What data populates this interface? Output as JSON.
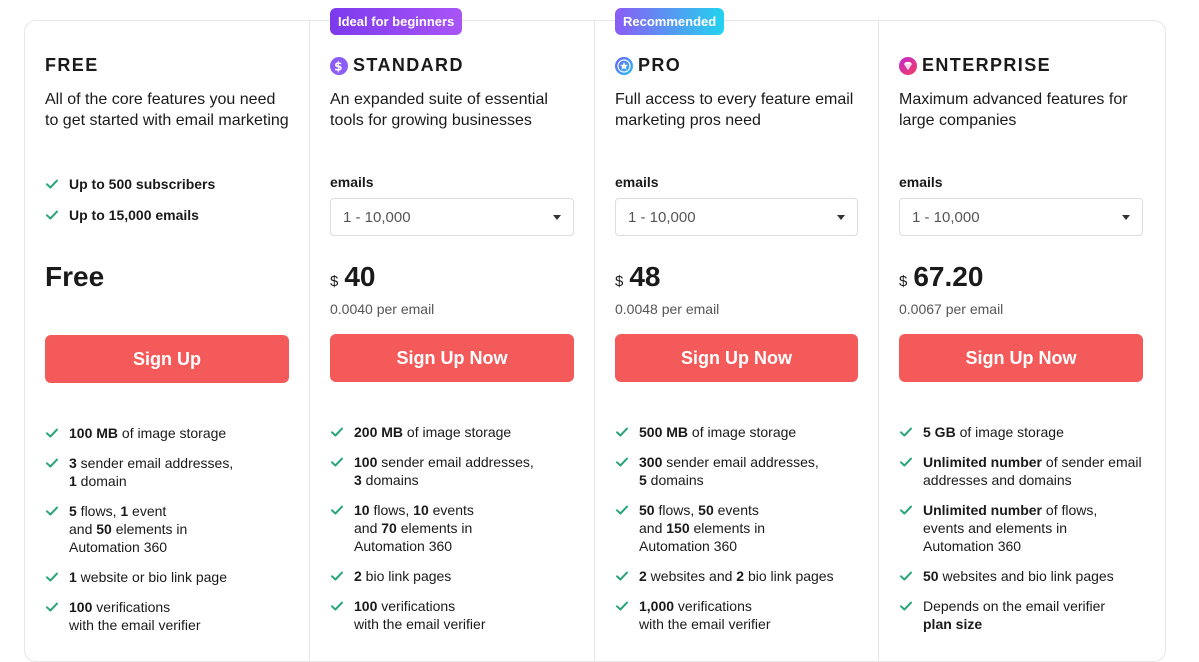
{
  "colors": {
    "accent": "#f55a5a",
    "check": "#2aa57a",
    "badge_purple": "#8b5cf6",
    "badge_teal": "#22d3ee"
  },
  "plans": [
    {
      "name": "FREE",
      "description": "All of the core features you need to get started with email marketing",
      "top_features": [
        "Up to 500 subscribers",
        "Up to 15,000 emails"
      ],
      "price_label": "Free",
      "cta": "Sign Up",
      "features": [
        {
          "parts": [
            {
              "b": "100 MB"
            },
            {
              "t": " of image storage"
            }
          ]
        },
        {
          "parts": [
            {
              "b": "3"
            },
            {
              "t": " sender email addresses,"
            },
            {
              "br": true
            },
            {
              "b": "1"
            },
            {
              "t": " domain"
            }
          ]
        },
        {
          "parts": [
            {
              "b": "5"
            },
            {
              "t": " flows, "
            },
            {
              "b": "1"
            },
            {
              "t": " event"
            },
            {
              "br": true
            },
            {
              "t": "and "
            },
            {
              "b": "50"
            },
            {
              "t": " elements in"
            },
            {
              "br": true
            },
            {
              "t": "Automation 360"
            }
          ]
        },
        {
          "parts": [
            {
              "b": "1"
            },
            {
              "t": " website or bio link page"
            }
          ]
        },
        {
          "parts": [
            {
              "b": "100"
            },
            {
              "t": " verifications"
            },
            {
              "br": true
            },
            {
              "t": "with the email verifier"
            }
          ]
        }
      ]
    },
    {
      "name": "STANDARD",
      "badge": "Ideal for beginners",
      "icon": "dollar-icon",
      "description": "An expanded suite of essential tools for growing businesses",
      "emails_label": "emails",
      "emails_selected": "1 - 10,000",
      "currency": "$",
      "price": "40",
      "per_email": "0.0040 per email",
      "cta": "Sign Up Now",
      "features": [
        {
          "parts": [
            {
              "b": "200 MB"
            },
            {
              "t": " of image storage"
            }
          ]
        },
        {
          "parts": [
            {
              "b": "100"
            },
            {
              "t": " sender email addresses,"
            },
            {
              "br": true
            },
            {
              "b": "3"
            },
            {
              "t": " domains"
            }
          ]
        },
        {
          "parts": [
            {
              "b": "10"
            },
            {
              "t": " flows, "
            },
            {
              "b": "10"
            },
            {
              "t": " events"
            },
            {
              "br": true
            },
            {
              "t": "and "
            },
            {
              "b": "70"
            },
            {
              "t": " elements in"
            },
            {
              "br": true
            },
            {
              "t": "Automation 360"
            }
          ]
        },
        {
          "parts": [
            {
              "b": "2"
            },
            {
              "t": " bio link pages"
            }
          ]
        },
        {
          "parts": [
            {
              "b": "100"
            },
            {
              "t": " verifications"
            },
            {
              "br": true
            },
            {
              "t": "with the email verifier"
            }
          ]
        }
      ]
    },
    {
      "name": "PRO",
      "badge": "Recommended",
      "icon": "star-icon",
      "description": "Full access to every feature email marketing pros need",
      "emails_label": "emails",
      "emails_selected": "1 - 10,000",
      "currency": "$",
      "price": "48",
      "per_email": "0.0048 per email",
      "cta": "Sign Up Now",
      "features": [
        {
          "parts": [
            {
              "b": "500 MB"
            },
            {
              "t": " of image storage"
            }
          ]
        },
        {
          "parts": [
            {
              "b": "300"
            },
            {
              "t": " sender email addresses,"
            },
            {
              "br": true
            },
            {
              "b": "5"
            },
            {
              "t": " domains"
            }
          ]
        },
        {
          "parts": [
            {
              "b": "50"
            },
            {
              "t": " flows, "
            },
            {
              "b": "50"
            },
            {
              "t": " events"
            },
            {
              "br": true
            },
            {
              "t": "and "
            },
            {
              "b": "150"
            },
            {
              "t": " elements in"
            },
            {
              "br": true
            },
            {
              "t": "Automation 360"
            }
          ]
        },
        {
          "parts": [
            {
              "b": "2"
            },
            {
              "t": " websites and "
            },
            {
              "b": "2"
            },
            {
              "t": " bio link pages"
            }
          ]
        },
        {
          "parts": [
            {
              "b": "1,000"
            },
            {
              "t": " verifications"
            },
            {
              "br": true
            },
            {
              "t": "with the email verifier"
            }
          ]
        }
      ]
    },
    {
      "name": "ENTERPRISE",
      "icon": "diamond-icon",
      "description": "Maximum advanced features for large companies",
      "emails_label": "emails",
      "emails_selected": "1 - 10,000",
      "currency": "$",
      "price": "67.20",
      "per_email": "0.0067 per email",
      "cta": "Sign Up Now",
      "features": [
        {
          "parts": [
            {
              "b": "5 GB"
            },
            {
              "t": " of image storage"
            }
          ]
        },
        {
          "parts": [
            {
              "b": "Unlimited number"
            },
            {
              "t": " of sender email"
            },
            {
              "br": true
            },
            {
              "t": "addresses and domains"
            }
          ]
        },
        {
          "parts": [
            {
              "b": "Unlimited number"
            },
            {
              "t": " of flows,"
            },
            {
              "br": true
            },
            {
              "t": "events and elements in"
            },
            {
              "br": true
            },
            {
              "t": "Automation 360"
            }
          ]
        },
        {
          "parts": [
            {
              "b": "50"
            },
            {
              "t": " websites and bio link pages"
            }
          ]
        },
        {
          "parts": [
            {
              "t": "Depends on the email verifier"
            },
            {
              "br": true
            },
            {
              "b": "plan size"
            }
          ]
        }
      ]
    }
  ]
}
